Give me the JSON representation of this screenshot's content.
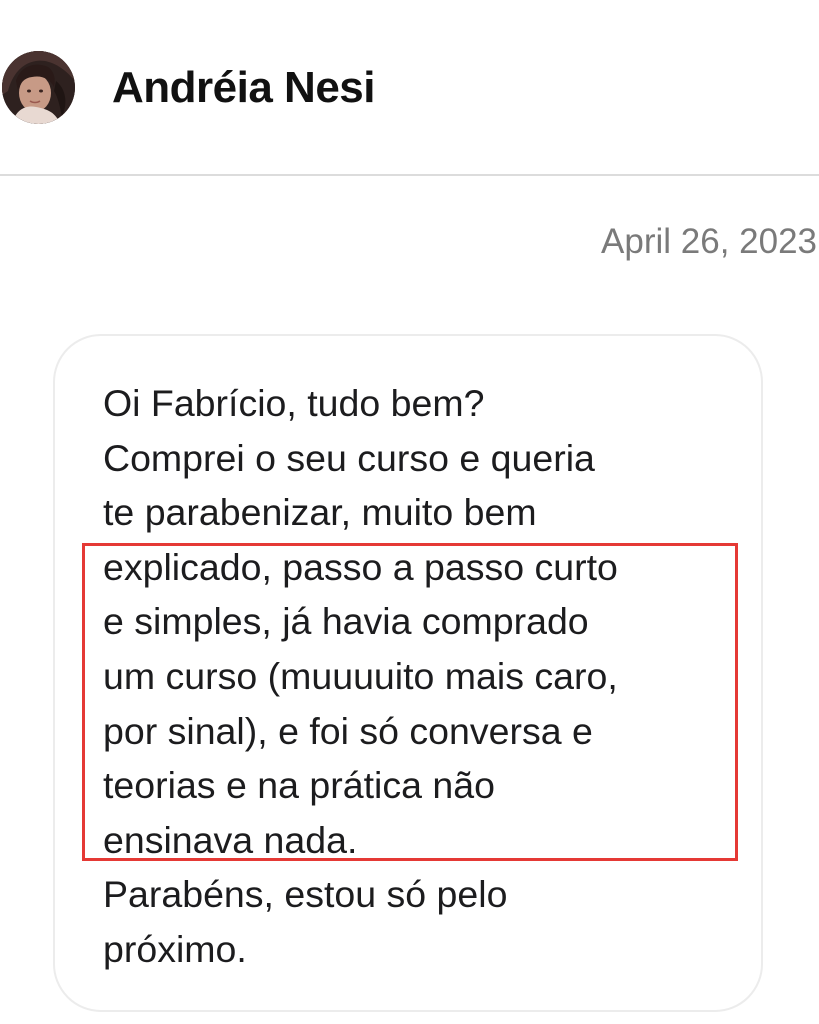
{
  "header": {
    "contact_name": "Andréia Nesi",
    "avatar_icon": "avatar-photo"
  },
  "conversation": {
    "date": "April 26, 2023",
    "message": {
      "lines": [
        "Oi Fabrício, tudo bem?",
        "Comprei o seu curso e queria",
        "te parabenizar, muito bem",
        "explicado, passo a passo curto",
        "e simples, já havia comprado",
        "um curso (muuuuito mais caro,",
        "por sinal), e foi só conversa e",
        "teorias e na prática não",
        "ensinava nada.",
        "Parabéns, estou só pelo",
        "próximo."
      ]
    },
    "highlight": {
      "color": "#e53935",
      "first_line_index": 3,
      "last_line_index": 8
    }
  }
}
